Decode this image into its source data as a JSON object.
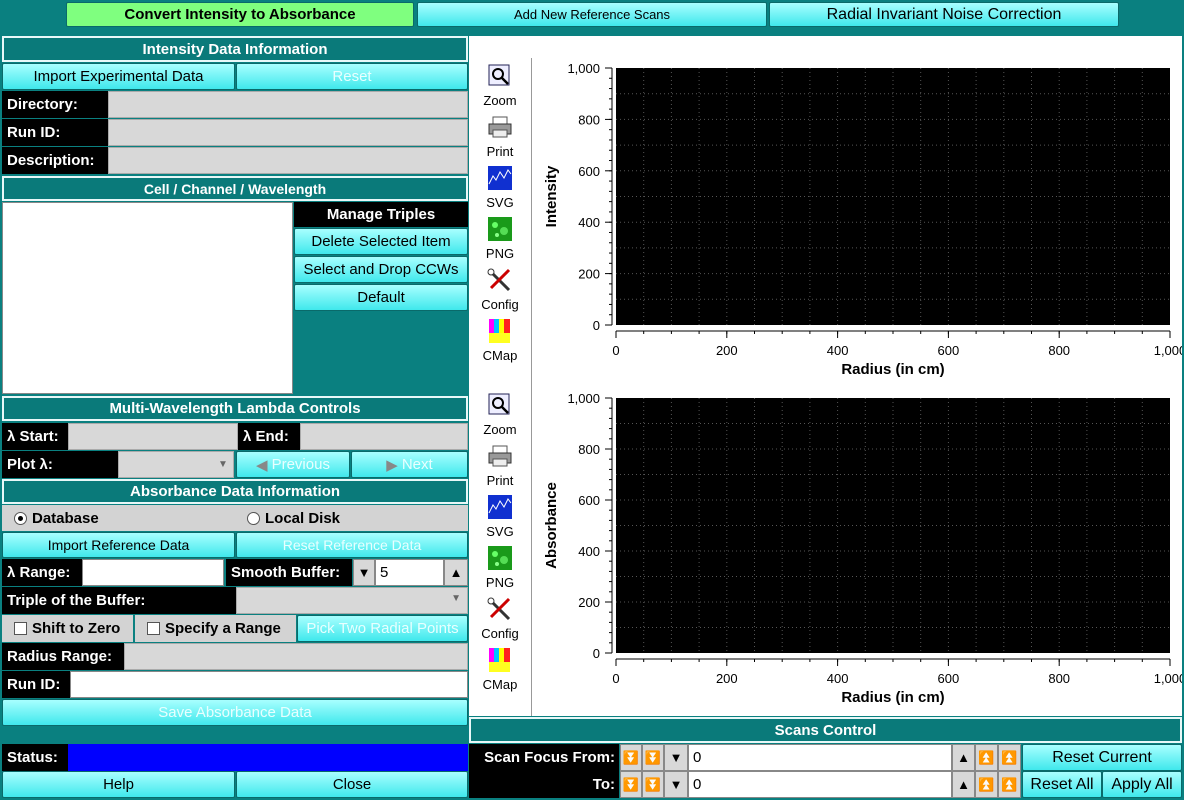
{
  "tabs": {
    "convert": "Convert Intensity to Absorbance",
    "add_ref": "Add New Reference Scans",
    "ri_noise": "Radial Invariant Noise Correction"
  },
  "intensity": {
    "header": "Intensity Data Information",
    "import": "Import Experimental Data",
    "reset": "Reset",
    "directory_label": "Directory:",
    "runid_label": "Run ID:",
    "description_label": "Description:",
    "directory": "",
    "runid": "",
    "description": ""
  },
  "ccw": {
    "header": "Cell / Channel / Wavelength",
    "manage": "Manage Triples",
    "delete": "Delete Selected Item",
    "select_drop": "Select and Drop CCWs",
    "default": "Default"
  },
  "lambda": {
    "header": "Multi-Wavelength Lambda Controls",
    "start_label": "λ Start:",
    "end_label": "λ End:",
    "plot_label": "Plot λ:",
    "previous": "Previous",
    "next": "Next"
  },
  "absorbance": {
    "header": "Absorbance Data Information",
    "database": "Database",
    "local_disk": "Local Disk",
    "import_ref": "Import Reference Data",
    "reset_ref": "Reset Reference Data",
    "range_label": "λ Range:",
    "smooth_label": "Smooth Buffer:",
    "smooth_value": "5",
    "triple_label": "Triple of the Buffer:",
    "shift_zero": "Shift to Zero",
    "specify_range": "Specify a Range",
    "pick_two": "Pick Two Radial Points",
    "radius_label": "Radius Range:",
    "runid_label": "Run ID:",
    "save": "Save Absorbance Data"
  },
  "status": {
    "label": "Status:",
    "help": "Help",
    "close": "Close"
  },
  "tools": [
    "Zoom",
    "Print",
    "SVG",
    "PNG",
    "Config",
    "CMap"
  ],
  "scans": {
    "header": "Scans Control",
    "focus_from": "Scan Focus From:",
    "to": "To:",
    "from_value": "0",
    "to_value": "0",
    "reset_current": "Reset Current",
    "reset_all": "Reset All",
    "apply_all": "Apply All"
  },
  "chart_data": [
    {
      "type": "line",
      "title": "",
      "xlabel": "Radius (in cm)",
      "ylabel": "Intensity",
      "xlim": [
        0,
        1000
      ],
      "ylim": [
        0,
        1000
      ],
      "xticks": [
        "0",
        "200",
        "400",
        "600",
        "800",
        "1,000"
      ],
      "yticks": [
        "0",
        "200",
        "400",
        "600",
        "800",
        "1,000"
      ],
      "grid": true,
      "series": []
    },
    {
      "type": "line",
      "title": "",
      "xlabel": "Radius (in cm)",
      "ylabel": "Absorbance",
      "xlim": [
        0,
        1000
      ],
      "ylim": [
        0,
        1000
      ],
      "xticks": [
        "0",
        "200",
        "400",
        "600",
        "800",
        "1,000"
      ],
      "yticks": [
        "0",
        "200",
        "400",
        "600",
        "800",
        "1,000"
      ],
      "grid": true,
      "series": []
    }
  ]
}
